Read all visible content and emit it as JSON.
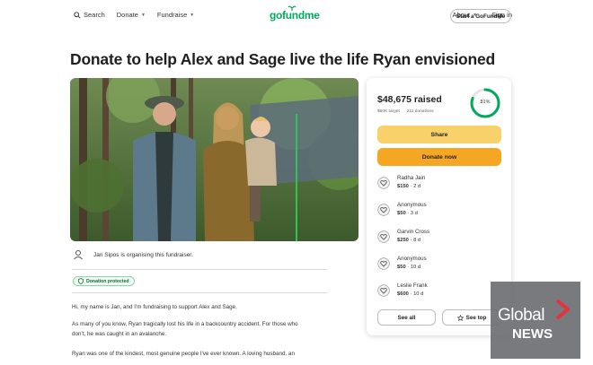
{
  "header": {
    "search_label": "Search",
    "donate_label": "Donate",
    "fundraise_label": "Fundraise",
    "logo_text": "gofundme",
    "about_label": "About",
    "signin_label": "Sign in",
    "start_label": "Start a GoFundMe"
  },
  "page": {
    "title": "Donate to help Alex and Sage live the life Ryan envisioned"
  },
  "organiser": {
    "text": "Jan Sipos is organising this fundraiser."
  },
  "badge": {
    "label": "Donation protected"
  },
  "story": [
    "Hi, my name is Jan, and I'm fundraising to support Alex and Sage.",
    "As many of you know, Ryan tragically lost his life in a backcountry accident. For those who",
    "don't, he was caught in an avalanche.",
    "Ryan was one of the kindest, most genuine people I've ever known. A loving husband, an"
  ],
  "card": {
    "raised": "$48,675 raised",
    "target": "$60K target",
    "donations": "211 donations",
    "percent_label": "81%",
    "progress": 0.81,
    "share_label": "Share",
    "donate_label": "Donate now",
    "see_all_label": "See all",
    "see_top_label": "See top"
  },
  "donations": [
    {
      "name": "Radha Jain",
      "amount": "$150",
      "time": "2 d"
    },
    {
      "name": "Anonymous",
      "amount": "$50",
      "time": "3 d"
    },
    {
      "name": "Garvin Cross",
      "amount": "$250",
      "time": "8 d"
    },
    {
      "name": "Anonymous",
      "amount": "$50",
      "time": "10 d"
    },
    {
      "name": "Leslie Frank",
      "amount": "$600",
      "time": "10 d"
    }
  ],
  "watermark": {
    "line1": "Global",
    "line2": "NEWS"
  },
  "colors": {
    "brand_green": "#02a95c",
    "share_yellow": "#f8d16b",
    "donate_orange": "#f5a623"
  }
}
